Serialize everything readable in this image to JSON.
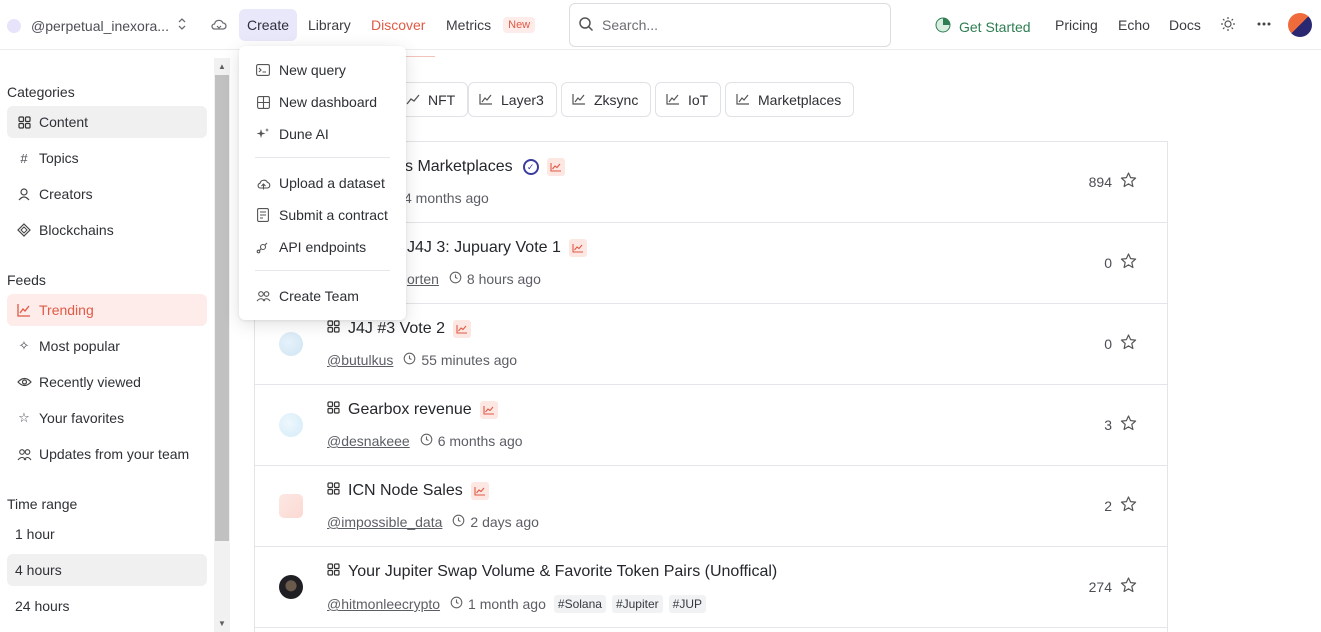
{
  "header": {
    "username": "@perpetual_inexora...",
    "nav": {
      "create": "Create",
      "library": "Library",
      "discover": "Discover",
      "metrics": "Metrics",
      "new_badge": "New"
    },
    "search_placeholder": "Search...",
    "get_started": "Get Started",
    "pricing": "Pricing",
    "echo": "Echo",
    "docs": "Docs",
    "colors": {
      "accent_red": "#e05a45",
      "create_bg": "#e9e8fb",
      "get_started_green": "#2f7d52"
    }
  },
  "create_menu": {
    "items": [
      {
        "label": "New query",
        "icon": "terminal-icon"
      },
      {
        "label": "New dashboard",
        "icon": "dashboard-icon"
      },
      {
        "label": "Dune AI",
        "icon": "sparkle-icon"
      },
      {
        "label": "Upload a dataset",
        "icon": "cloud-upload-icon"
      },
      {
        "label": "Submit a contract",
        "icon": "contract-icon"
      },
      {
        "label": "API endpoints",
        "icon": "api-icon"
      },
      {
        "label": "Create Team",
        "icon": "team-icon"
      }
    ]
  },
  "sidebar": {
    "categories_heading": "Categories",
    "categories": [
      {
        "label": "Content",
        "icon": "grid-icon"
      },
      {
        "label": "Topics",
        "icon": "hash-icon"
      },
      {
        "label": "Creators",
        "icon": "creator-icon"
      },
      {
        "label": "Blockchains",
        "icon": "diamond-icon"
      }
    ],
    "feeds_heading": "Feeds",
    "feeds": [
      {
        "label": "Trending",
        "icon": "trending-icon"
      },
      {
        "label": "Most popular",
        "icon": "sparkle-star-icon"
      },
      {
        "label": "Recently viewed",
        "icon": "eye-icon"
      },
      {
        "label": "Your favorites",
        "icon": "star-icon"
      },
      {
        "label": "Updates from your team",
        "icon": "team-icon"
      }
    ],
    "time_range_heading": "Time range",
    "time_ranges": [
      {
        "label": "1 hour"
      },
      {
        "label": "4 hours"
      },
      {
        "label": "24 hours"
      }
    ]
  },
  "filter_chips": [
    {
      "label": "NFT"
    },
    {
      "label": "Layer3"
    },
    {
      "label": "Zksync"
    },
    {
      "label": "IoT"
    },
    {
      "label": "Marketplaces"
    }
  ],
  "dashboards": [
    {
      "title": "s Marketplaces",
      "author": "",
      "time": "4 months ago",
      "stars": "894",
      "tags": []
    },
    {
      "title": "J4J 3: Jupuary Vote 1",
      "author": "orten",
      "time": "8 hours ago",
      "stars": "0",
      "tags": []
    },
    {
      "title": "J4J #3 Vote 2",
      "author": "@butulkus",
      "time": "55 minutes ago",
      "stars": "0",
      "tags": []
    },
    {
      "title": "Gearbox revenue",
      "author": "@desnakeee",
      "time": "6 months ago",
      "stars": "3",
      "tags": []
    },
    {
      "title": "ICN Node Sales",
      "author": "@impossible_data",
      "time": "2 days ago",
      "stars": "2",
      "tags": []
    },
    {
      "title": "Your Jupiter Swap Volume & Favorite Token Pairs (Unoffical)",
      "author": "@hitmonleecrypto",
      "time": "1 month ago",
      "stars": "274",
      "tags": [
        "#Solana",
        "#Jupiter",
        "#JUP"
      ]
    }
  ]
}
